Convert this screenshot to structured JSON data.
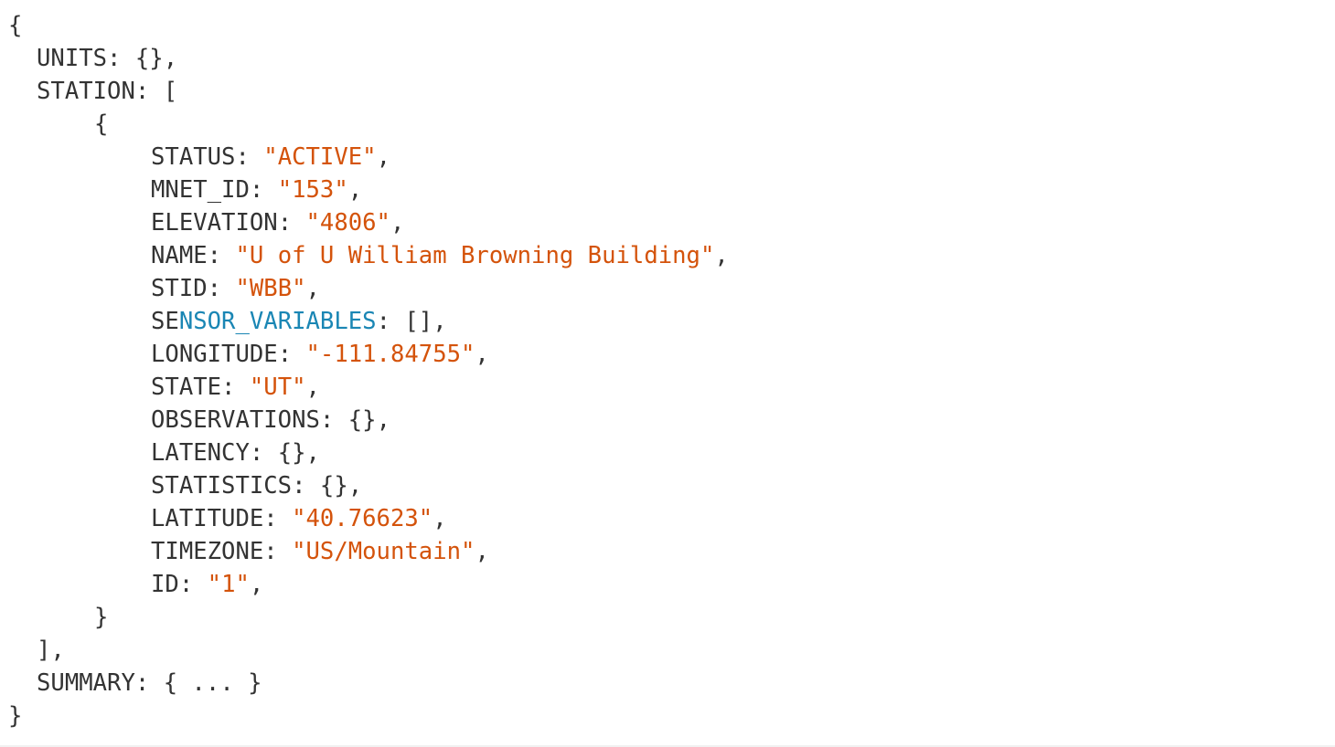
{
  "colors": {
    "text": "#333333",
    "string_value": "#d4530b",
    "highlight_key": "#1a86b4",
    "background": "#ffffff"
  },
  "tokens": {
    "open_brace": "{",
    "close_brace": "}",
    "open_bracket": "[",
    "close_bracket_comma": "],",
    "empty_object": "{}",
    "empty_array": "[]",
    "collapsed_object": "{ ... }"
  },
  "units": {
    "key": "UNITS",
    "value": "{}"
  },
  "station_key": "STATION",
  "station": {
    "status": {
      "key": "STATUS",
      "value": "\"ACTIVE\""
    },
    "mnet_id": {
      "key": "MNET_ID",
      "value": "\"153\""
    },
    "elevation": {
      "key": "ELEVATION",
      "value": "\"4806\""
    },
    "name": {
      "key": "NAME",
      "value": "\"U of U William Browning Building\""
    },
    "stid": {
      "key": "STID",
      "value": "\"WBB\""
    },
    "sensor_variables": {
      "key_prefix": "SE",
      "key_link": "NSOR_VARIABLES",
      "value": "[]"
    },
    "longitude": {
      "key": "LONGITUDE",
      "value": "\"-111.84755\""
    },
    "state": {
      "key": "STATE",
      "value": "\"UT\""
    },
    "observations": {
      "key": "OBSERVATIONS",
      "value": "{}"
    },
    "latency": {
      "key": "LATENCY",
      "value": "{}"
    },
    "statistics": {
      "key": "STATISTICS",
      "value": "{}"
    },
    "latitude": {
      "key": "LATITUDE",
      "value": "\"40.76623\""
    },
    "timezone": {
      "key": "TIMEZONE",
      "value": "\"US/Mountain\""
    },
    "id": {
      "key": "ID",
      "value": "\"1\""
    }
  },
  "summary": {
    "key": "SUMMARY",
    "value": "{ ... }"
  }
}
